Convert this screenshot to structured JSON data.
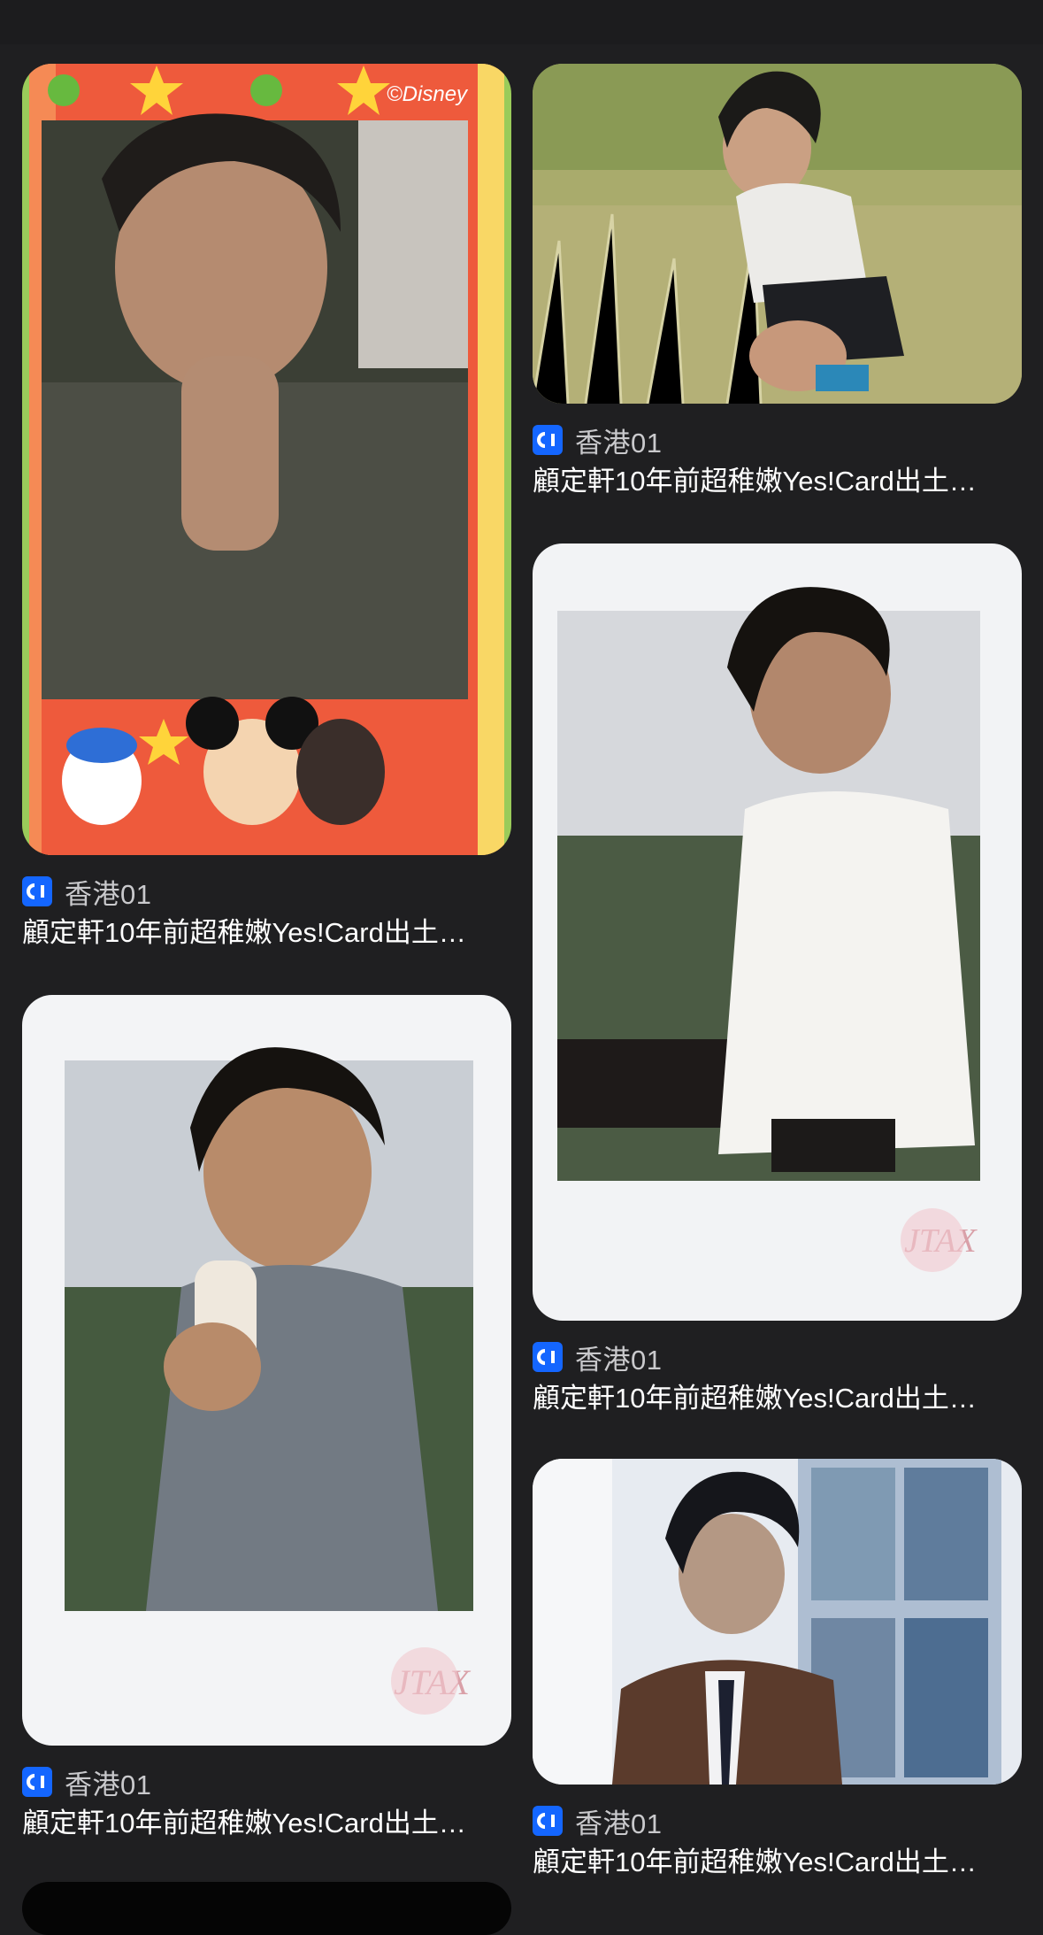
{
  "results": [
    {
      "source": "香港01",
      "title": "顧定軒10年前超稚嫩Yes!Card出土…",
      "image_desc": "disney-card-photo"
    },
    {
      "source": "香港01",
      "title": "顧定軒10年前超稚嫩Yes!Card出土…",
      "image_desc": "grass-field-photo"
    },
    {
      "source": "香港01",
      "title": "顧定軒10年前超稚嫩Yes!Card出土…",
      "image_desc": "polaroid-milk-photo"
    },
    {
      "source": "香港01",
      "title": "顧定軒10年前超稚嫩Yes!Card出土…",
      "image_desc": "polaroid-white-shirt-photo"
    },
    {
      "source": "香港01",
      "title": "顧定軒10年前超稚嫩Yes!Card出土…",
      "image_desc": "window-cardigan-photo"
    }
  ],
  "colors": {
    "background": "#1f1f21",
    "source_logo": "#1466ff",
    "source_text": "#c9c9cc",
    "title_text": "#ffffff"
  },
  "icons": {
    "source_logo": "hk01-logo-icon"
  }
}
